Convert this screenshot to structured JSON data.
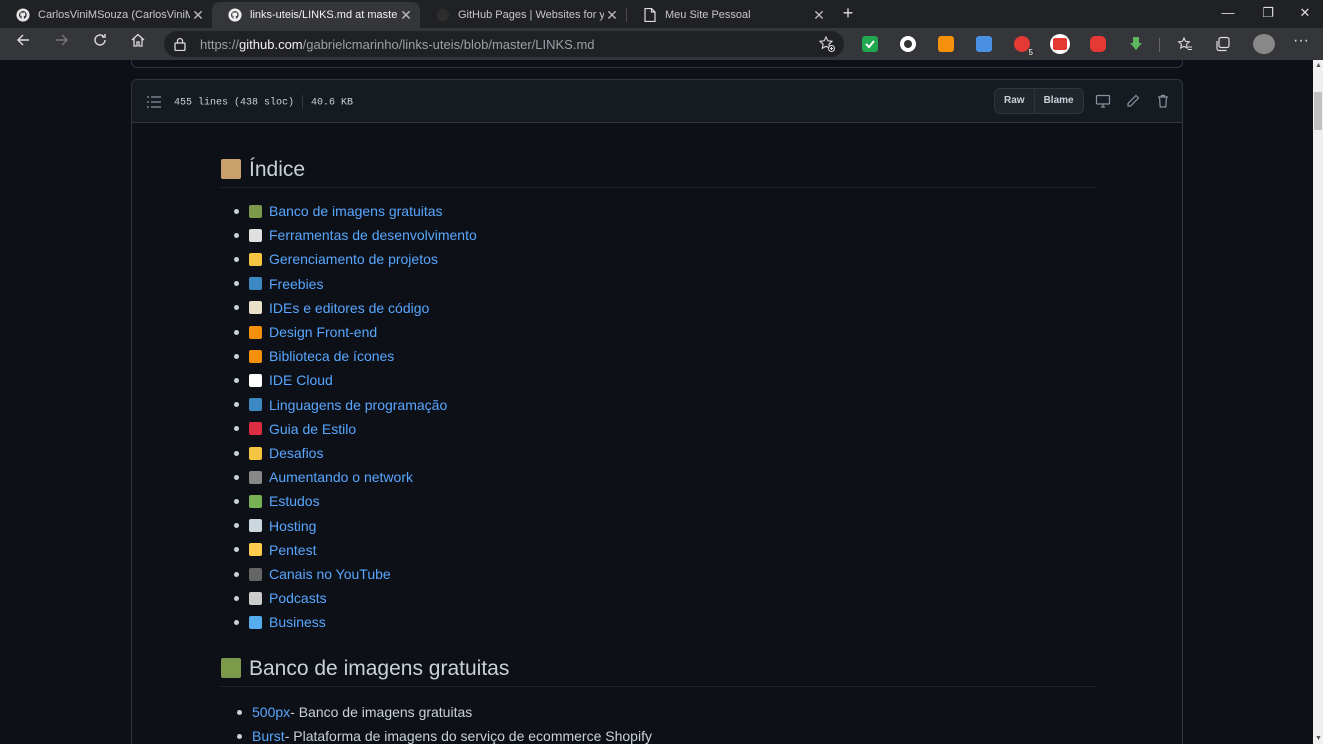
{
  "browser": {
    "tabs": [
      {
        "title": "CarlosViniMSouza (CarlosViniMS",
        "icon": "github-icon",
        "active": false
      },
      {
        "title": "links-uteis/LINKS.md at master ·",
        "icon": "github-icon",
        "active": true
      },
      {
        "title": "GitHub Pages | Websites for you",
        "icon": "github-icon",
        "active": false
      },
      {
        "title": "Meu Site Pessoal",
        "icon": "page-icon",
        "active": false
      }
    ],
    "address": {
      "scheme": "https://",
      "host": "github.com",
      "path": "/gabrielcmarinho/links-uteis/blob/master/LINKS.md"
    },
    "extension_badge": "5"
  },
  "file": {
    "lines_info": "455 lines (438 sloc)",
    "size": "40.6 KB",
    "raw_label": "Raw",
    "blame_label": "Blame"
  },
  "markdown": {
    "index_heading": "Índice",
    "index_items": [
      {
        "label": "Banco de imagens gratuitas",
        "emoji": "picture-emoji",
        "color": "#7b9b4a"
      },
      {
        "label": "Ferramentas de desenvolvimento",
        "emoji": "wand-emoji",
        "color": "#e0e0e0"
      },
      {
        "label": "Gerenciamento de projetos",
        "emoji": "folder-emoji",
        "color": "#f5c542"
      },
      {
        "label": "Freebies",
        "emoji": "free-emoji",
        "color": "#3b88c3"
      },
      {
        "label": "IDEs e editores de código",
        "emoji": "memo-emoji",
        "color": "#e8e0c8"
      },
      {
        "label": "Design Front-end",
        "emoji": "pencil-emoji",
        "color": "#f4900c"
      },
      {
        "label": "Biblioteca de ícones",
        "emoji": "pencil-emoji",
        "color": "#f4900c"
      },
      {
        "label": "IDE Cloud",
        "emoji": "cloud-emoji",
        "color": "#ffffff"
      },
      {
        "label": "Linguagens de programação",
        "emoji": "abc-emoji",
        "color": "#3b88c3"
      },
      {
        "label": "Guia de Estilo",
        "emoji": "book-emoji",
        "color": "#dd2e44"
      },
      {
        "label": "Desafios",
        "emoji": "folder-emoji",
        "color": "#f5c542"
      },
      {
        "label": "Aumentando o network",
        "emoji": "people-emoji",
        "color": "#888888"
      },
      {
        "label": "Estudos",
        "emoji": "student-emoji",
        "color": "#77b255"
      },
      {
        "label": "Hosting",
        "emoji": "hospital-emoji",
        "color": "#ccd6dd"
      },
      {
        "label": "Pentest",
        "emoji": "lock-emoji",
        "color": "#ffcc4d"
      },
      {
        "label": "Canais no YouTube",
        "emoji": "camera-emoji",
        "color": "#666666"
      },
      {
        "label": "Podcasts",
        "emoji": "microphone-emoji",
        "color": "#cccccc"
      },
      {
        "label": "Business",
        "emoji": "office-emoji",
        "color": "#55acee"
      }
    ],
    "section_heading": "Banco de imagens gratuitas",
    "section_items": [
      {
        "link": "500px",
        "desc": " - Banco de imagens gratuitas"
      },
      {
        "link": "Burst",
        "desc": " - Plataforma de imagens do serviço de ecommerce Shopify"
      }
    ]
  },
  "colors": {
    "link": "#58a6ff",
    "background": "#0d1117",
    "header": "#161b22"
  }
}
